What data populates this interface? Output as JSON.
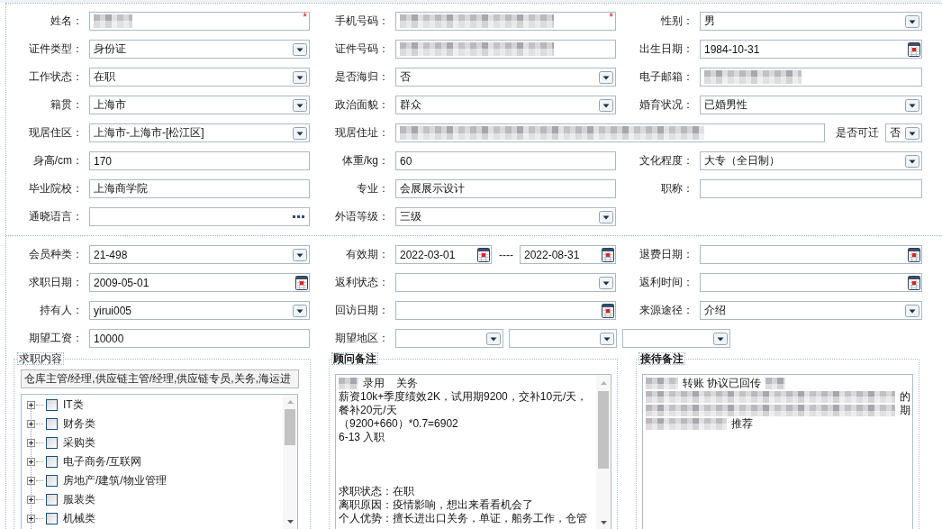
{
  "basic_info": {
    "rows": [
      [
        {
          "label": "姓名：",
          "kind": "text",
          "redaction": {
            "kind": "short"
          },
          "mark": "*"
        },
        {
          "label": "手机号码：",
          "kind": "text",
          "redaction": {
            "kind": "long"
          },
          "mark": "*"
        },
        {
          "label": "性别：",
          "kind": "select",
          "value": "男"
        }
      ],
      [
        {
          "label": "证件类型：",
          "kind": "select",
          "value": "身份证"
        },
        {
          "label": "证件号码：",
          "kind": "text",
          "redaction": {
            "kind": "long"
          }
        },
        {
          "label": "出生日期：",
          "kind": "date",
          "value": "1984-10-31"
        }
      ],
      [
        {
          "label": "工作状态：",
          "kind": "select",
          "value": "在职"
        },
        {
          "label": "是否海归：",
          "kind": "select",
          "value": "否"
        },
        {
          "label": "电子邮箱：",
          "kind": "text",
          "redaction": {
            "kind": "medium"
          }
        }
      ],
      [
        {
          "label": "籍贯：",
          "kind": "select",
          "value": "上海市"
        },
        {
          "label": "政治面貌：",
          "kind": "select",
          "value": "群众"
        },
        {
          "label": "婚育状况：",
          "kind": "select",
          "value": "已婚男性"
        }
      ],
      [
        {
          "label": "现居住区：",
          "kind": "select",
          "value": "上海市-上海市-[松江区]"
        },
        {
          "label": "现居住址：",
          "kind": "text",
          "redaction": {
            "kind": "long"
          },
          "aside": {
            "label": "是否可迁",
            "kind": "select",
            "value": "否"
          }
        }
      ],
      [
        {
          "label": "身高/cm：",
          "kind": "text",
          "value": "170"
        },
        {
          "label": "体重/kg：",
          "kind": "text",
          "value": "60"
        },
        {
          "label": "文化程度：",
          "kind": "select",
          "value": "大专（全日制）"
        }
      ],
      [
        {
          "label": "毕业院校：",
          "kind": "text",
          "value": "上海商学院"
        },
        {
          "label": "专业：",
          "kind": "text",
          "value": "会展展示设计"
        },
        {
          "label": "职称：",
          "kind": "text"
        }
      ],
      [
        {
          "label": "通晓语言：",
          "kind": "picker"
        },
        {
          "label": "外语等级：",
          "kind": "select",
          "value": "三级"
        }
      ]
    ]
  },
  "membership": {
    "rows": [
      [
        {
          "label": "会员种类：",
          "kind": "select",
          "value": "21-498"
        },
        {
          "label": "有效期：",
          "kind": "group",
          "parts": [
            {
              "kind": "date",
              "value": "2022-03-01"
            },
            {
              "kind": "separator",
              "text": "----"
            },
            {
              "kind": "date",
              "value": "2022-08-31"
            }
          ]
        },
        {
          "label": "退费日期：",
          "kind": "date"
        }
      ],
      [
        {
          "label": "求职日期：",
          "kind": "date",
          "value": "2009-05-01"
        },
        {
          "label": "返利状态：",
          "kind": "select"
        },
        {
          "label": "返利时间：",
          "kind": "date"
        }
      ],
      [
        {
          "label": "持有人：",
          "kind": "select",
          "value": "yirui005"
        },
        {
          "label": "回访日期：",
          "kind": "date"
        },
        {
          "label": "来源途径：",
          "kind": "select",
          "value": "介绍"
        }
      ],
      [
        {
          "label": "期望工资：",
          "kind": "text",
          "value": "10000"
        },
        {
          "label": "期望地区：",
          "kind": "group",
          "parts": [
            {
              "kind": "select"
            },
            {
              "kind": "select"
            },
            {
              "kind": "select"
            }
          ]
        }
      ]
    ]
  },
  "panels": [
    {
      "kind": "tree",
      "legend": "求职内容",
      "selection": "仓库主管/经理,供应链主管/经理,供应链专员,关务,海运进",
      "items": [
        {
          "label": "IT类",
          "expanded": false,
          "checked": false
        },
        {
          "label": "财务类",
          "expanded": false,
          "checked": false
        },
        {
          "label": "采购类",
          "expanded": false,
          "checked": false
        },
        {
          "label": "电子商务/互联网",
          "expanded": false,
          "checked": false
        },
        {
          "label": "房地产/建筑/物业管理",
          "expanded": false,
          "checked": false
        },
        {
          "label": "服装类",
          "expanded": false,
          "checked": false
        },
        {
          "label": "机械类",
          "expanded": false,
          "checked": false
        }
      ]
    },
    {
      "kind": "notes",
      "legend": "顾问备注",
      "scrollable": true,
      "paragraphs": [
        [
          [
            {
              "kind": "redacted-short"
            },
            {
              "kind": "text",
              "text": "录用    关务"
            }
          ],
          [
            {
              "kind": "text",
              "text": "薪资10k+季度绩效2K，试用期9200，交补10元/天，"
            }
          ],
          [
            {
              "kind": "text",
              "text": "餐补20元/天"
            }
          ],
          [
            {
              "kind": "text",
              "text": "（9200+660）*0.7=6902"
            }
          ],
          [
            {
              "kind": "text",
              "text": "6-13 入职"
            }
          ]
        ],
        [
          [
            {
              "kind": "text",
              "text": "求职状态：在职"
            }
          ],
          [
            {
              "kind": "text",
              "text": "离职原因：疫情影响，想出来看看机会了"
            }
          ],
          [
            {
              "kind": "text",
              "text": "个人优势：擅长进出口关务，单证，船务工作，仓管"
            }
          ]
        ]
      ]
    },
    {
      "kind": "notes",
      "legend": "接待备注",
      "paragraphs": [
        [
          [
            {
              "kind": "redacted-medium"
            },
            {
              "kind": "text",
              "text": "转账 协议已回传"
            },
            {
              "kind": "redacted-short"
            }
          ],
          [
            {
              "kind": "redacted-fill"
            },
            {
              "kind": "text",
              "text": "的"
            }
          ],
          [
            {
              "kind": "redacted-fill"
            },
            {
              "kind": "text",
              "text": "期"
            }
          ],
          [
            {
              "kind": "redacted-long"
            },
            {
              "kind": "text",
              "text": "推荐"
            }
          ]
        ]
      ]
    }
  ]
}
